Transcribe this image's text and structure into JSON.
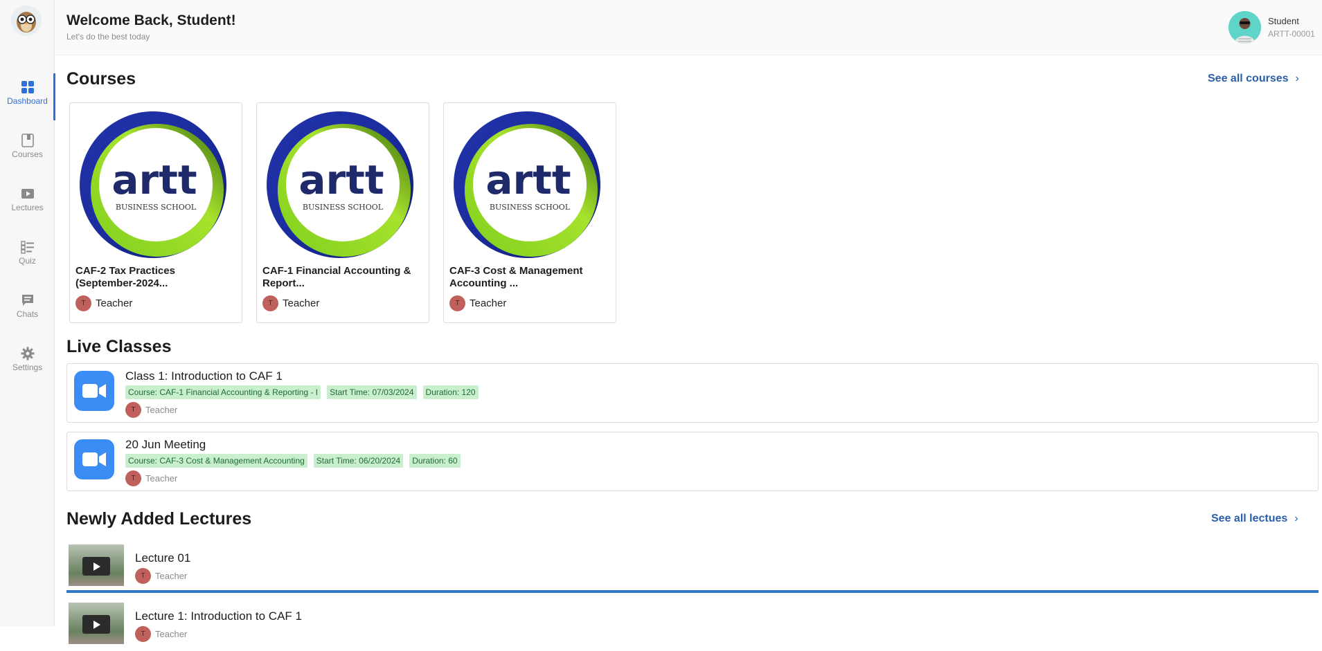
{
  "sidebar": {
    "items": [
      {
        "label": "Dashboard",
        "icon": "grid-icon",
        "active": true
      },
      {
        "label": "Courses",
        "icon": "book-icon"
      },
      {
        "label": "Lectures",
        "icon": "play-icon"
      },
      {
        "label": "Quiz",
        "icon": "checklist-icon"
      },
      {
        "label": "Chats",
        "icon": "chat-icon"
      },
      {
        "label": "Settings",
        "icon": "gear-icon"
      }
    ],
    "accent": "#2f6fd8"
  },
  "header": {
    "title": "Welcome Back, Student!",
    "subtitle": "Let's do the best today",
    "user_name": "Student",
    "user_id": "ARTT-00001"
  },
  "courses": {
    "title": "Courses",
    "see_all": "See all courses",
    "logo_text": "artt",
    "logo_sub": "BUSINESS SCHOOL",
    "items": [
      {
        "title": "CAF-2 Tax Practices (September-2024...",
        "teacher_initial": "T",
        "teacher": "Teacher"
      },
      {
        "title": "CAF-1 Financial Accounting & Report...",
        "teacher_initial": "T",
        "teacher": "Teacher"
      },
      {
        "title": "CAF-3 Cost & Management Accounting ...",
        "teacher_initial": "T",
        "teacher": "Teacher"
      }
    ]
  },
  "live_classes": {
    "title": "Live Classes",
    "items": [
      {
        "title": "Class 1: Introduction to CAF 1",
        "course": "Course: CAF-1 Financial Accounting & Reporting - I",
        "start": "Start Time: 07/03/2024",
        "duration": "Duration: 120",
        "teacher_initial": "T",
        "teacher": "Teacher"
      },
      {
        "title": "20 Jun Meeting",
        "course": "Course: CAF-3 Cost & Management Accounting",
        "start": "Start Time: 06/20/2024",
        "duration": "Duration: 60",
        "teacher_initial": "T",
        "teacher": "Teacher"
      }
    ],
    "tag_bg": "#c9efcf"
  },
  "lectures": {
    "title": "Newly Added Lectures",
    "see_all": "See all lectues",
    "items": [
      {
        "title": "Lecture 01",
        "teacher_initial": "T",
        "teacher": "Teacher"
      },
      {
        "title": "Lecture 1: Introduction to CAF 1",
        "teacher_initial": "T",
        "teacher": "Teacher"
      }
    ]
  }
}
